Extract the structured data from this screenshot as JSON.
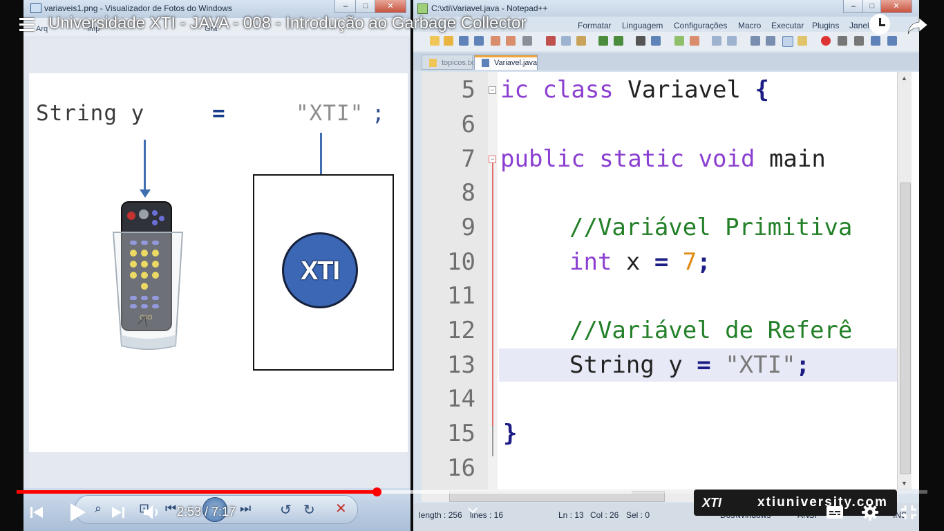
{
  "video": {
    "title": "Universidade XTI - JAVA - 008 - Introdução ao Garbage Collector",
    "time_display": "2:53 / 7:17",
    "progress_played": 0.395,
    "progress_loaded": 0.675,
    "watermark_logo": "XTI",
    "watermark_url": "xtiuniversity.com"
  },
  "photo_viewer": {
    "title": "variaveis1.png - Visualizador de Fotos do Windows",
    "menu": [
      "Arq",
      "Imp",
      "Gra"
    ],
    "slide": {
      "code_type": "String y",
      "code_eq": "=",
      "code_literal": "\"XTI\"",
      "code_semi": ";",
      "object_label": "XTI",
      "remote_brand": "C6O"
    }
  },
  "npp": {
    "title": "C:\\xti\\Variavel.java - Notepad++",
    "menu": [
      "Formatar",
      "Linguagem",
      "Configurações",
      "Macro",
      "Executar",
      "Plugins",
      "Janel"
    ],
    "tabs": [
      {
        "label": "topicos.txt",
        "active": false
      },
      {
        "label": "Variavel.java",
        "active": true
      }
    ],
    "lines": [
      {
        "n": "5"
      },
      {
        "n": "6"
      },
      {
        "n": "7"
      },
      {
        "n": "8"
      },
      {
        "n": "9"
      },
      {
        "n": "10"
      },
      {
        "n": "11"
      },
      {
        "n": "12"
      },
      {
        "n": "13"
      },
      {
        "n": "14"
      },
      {
        "n": "15"
      },
      {
        "n": "16"
      }
    ],
    "code": {
      "l5_kw": "ic class",
      "l5_rest": " Variavel ",
      "l5_brace": "{",
      "l7_kw": "public static void",
      "l7_rest": " main",
      "l9_comment": "//Variável Primitiva",
      "l10_kw": "int",
      "l10_var": " x ",
      "l10_eq": "=",
      "l10_num": " 7",
      "l10_semi": ";",
      "l12_comment": "//Variável de Referê",
      "l13_type": "String y ",
      "l13_eq": "=",
      "l13_str": " \"XTI\"",
      "l13_semi": ";",
      "l15_brace": "}"
    },
    "status": {
      "length": "length : 256",
      "lines": "lines : 16",
      "ln": "Ln : 13",
      "col": "Col : 26",
      "sel": "Sel : 0",
      "eol": "Dos\\Windows",
      "enc": "ANSI",
      "mode": "INS"
    }
  },
  "colors": {
    "accent_red": "#ff0000",
    "java_keyword": "#8b3fd1",
    "java_comment": "#238028",
    "number": "#e08a12",
    "xti_blue": "#3b67b4"
  }
}
